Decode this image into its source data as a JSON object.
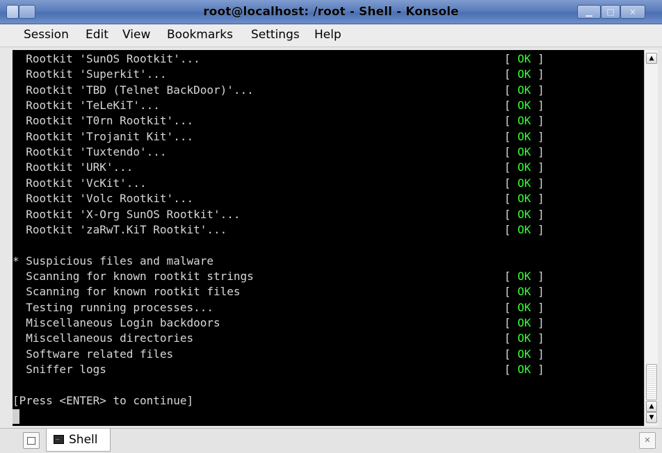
{
  "window": {
    "title": "root@localhost: /root - Shell - Konsole"
  },
  "menu": [
    "Session",
    "Edit",
    "View",
    "Bookmarks",
    "Settings",
    "Help"
  ],
  "terminal": {
    "lines": [
      {
        "text": "  Rootkit 'SunOS Rootkit'...",
        "status": "OK"
      },
      {
        "text": "  Rootkit 'Superkit'...",
        "status": "OK"
      },
      {
        "text": "  Rootkit 'TBD (Telnet BackDoor)'...",
        "status": "OK"
      },
      {
        "text": "  Rootkit 'TeLeKiT'...",
        "status": "OK"
      },
      {
        "text": "  Rootkit 'T0rn Rootkit'...",
        "status": "OK"
      },
      {
        "text": "  Rootkit 'Trojanit Kit'...",
        "status": "OK"
      },
      {
        "text": "  Rootkit 'Tuxtendo'...",
        "status": "OK"
      },
      {
        "text": "  Rootkit 'URK'...",
        "status": "OK"
      },
      {
        "text": "  Rootkit 'VcKit'...",
        "status": "OK"
      },
      {
        "text": "  Rootkit 'Volc Rootkit'...",
        "status": "OK"
      },
      {
        "text": "  Rootkit 'X-Org SunOS Rootkit'...",
        "status": "OK"
      },
      {
        "text": "  Rootkit 'zaRwT.KiT Rootkit'...",
        "status": "OK"
      },
      {
        "text": "",
        "status": ""
      },
      {
        "text": "* Suspicious files and malware",
        "status": ""
      },
      {
        "text": "  Scanning for known rootkit strings",
        "status": "OK"
      },
      {
        "text": "  Scanning for known rootkit files",
        "status": "OK"
      },
      {
        "text": "  Testing running processes...",
        "status": "OK"
      },
      {
        "text": "  Miscellaneous Login backdoors",
        "status": "OK"
      },
      {
        "text": "  Miscellaneous directories",
        "status": "OK"
      },
      {
        "text": "  Software related files",
        "status": "OK"
      },
      {
        "text": "  Sniffer logs",
        "status": "OK"
      },
      {
        "text": "",
        "status": ""
      },
      {
        "text": "[Press <ENTER> to continue]",
        "status": ""
      }
    ],
    "ok_color": "#33ff33"
  },
  "tabs": [
    {
      "label": "Shell",
      "icon": "terminal-icon"
    }
  ],
  "icons": {
    "window_menu": "window-menu-icon",
    "minimize": "minimize-icon",
    "maximize": "maximize-icon",
    "close": "close-icon",
    "new_tab": "new-tab-icon",
    "close_tab": "close-tab-icon",
    "scroll_up": "arrow-up-icon",
    "scroll_down": "arrow-down-icon"
  }
}
